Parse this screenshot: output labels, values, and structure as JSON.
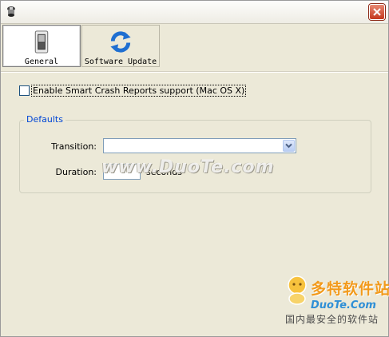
{
  "toolbar": {
    "tabs": [
      {
        "label": "General",
        "icon": "switch-icon"
      },
      {
        "label": "Software Update",
        "icon": "refresh-icon"
      }
    ]
  },
  "options": {
    "crash_reports_label": "Enable Smart Crash Reports support (Mac OS X)",
    "crash_reports_checked": false
  },
  "defaults_group": {
    "title": "Defaults",
    "transition_label": "Transition:",
    "transition_value": "",
    "duration_label": "Duration:",
    "duration_value": "",
    "duration_units": "seconds"
  },
  "watermark": {
    "text": "www.DuoTe.com"
  },
  "brand": {
    "name": "多特软件站",
    "site": "DuoTe.Com",
    "slogan": "国内最安全的软件站"
  },
  "colors": {
    "window_bg": "#ece9d8",
    "group_title": "#0046d5",
    "close_button": "#c4371c",
    "brand_orange": "#f29a1b",
    "brand_blue": "#2f8fd6"
  }
}
